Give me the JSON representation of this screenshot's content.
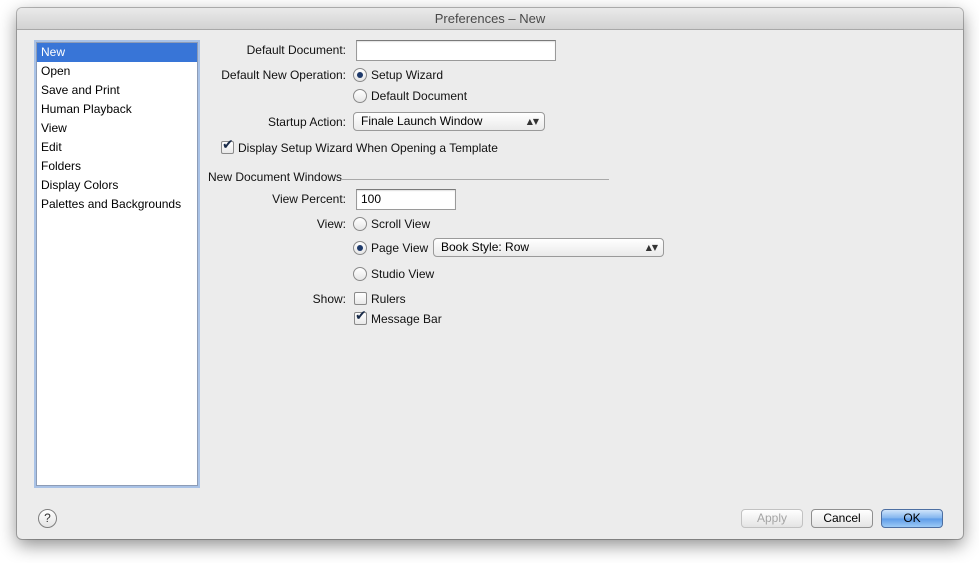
{
  "window": {
    "title": "Preferences – New"
  },
  "sidebar": {
    "items": [
      {
        "label": "New",
        "selected": true
      },
      {
        "label": "Open"
      },
      {
        "label": "Save and Print"
      },
      {
        "label": "Human Playback"
      },
      {
        "label": "View"
      },
      {
        "label": "Edit"
      },
      {
        "label": "Folders"
      },
      {
        "label": "Display Colors"
      },
      {
        "label": "Palettes and Backgrounds"
      }
    ]
  },
  "form": {
    "default_document_label": "Default Document:",
    "default_document_value": "",
    "default_new_operation_label": "Default New Operation:",
    "op_setup_wizard": "Setup Wizard",
    "op_default_document": "Default Document",
    "op_selected": "Setup Wizard",
    "startup_action_label": "Startup Action:",
    "startup_action_value": "Finale Launch Window",
    "display_wizard_label": "Display Setup Wizard When Opening a Template",
    "display_wizard_checked": true,
    "section_title": "New Document Windows",
    "view_percent_label": "View Percent:",
    "view_percent_value": "100",
    "view_label": "View:",
    "view_scroll": "Scroll View",
    "view_page": "Page View",
    "view_studio": "Studio View",
    "view_selected": "Page View",
    "page_view_style": "Book Style: Row",
    "show_label": "Show:",
    "show_rulers": "Rulers",
    "show_rulers_checked": false,
    "show_message_bar": "Message Bar",
    "show_message_bar_checked": true
  },
  "footer": {
    "help_glyph": "?",
    "apply_label": "Apply",
    "cancel_label": "Cancel",
    "ok_label": "OK"
  },
  "colors": {
    "selection": "#3875d7",
    "window_bg": "#ececec",
    "default_button": "#6aa4ea"
  }
}
